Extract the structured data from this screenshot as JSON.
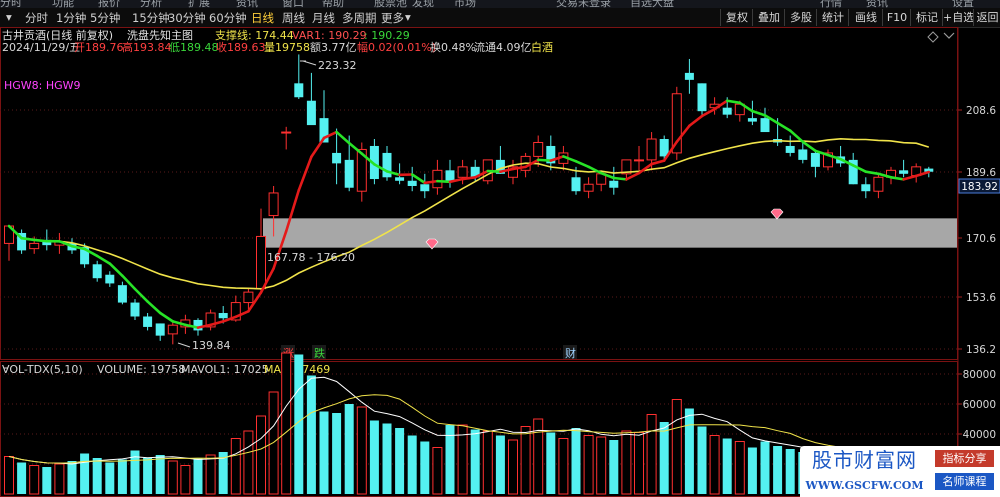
{
  "top_strip": {
    "items": [
      "分时",
      "功能",
      "报价",
      "分析",
      "扩展",
      "资讯",
      "窗口",
      "帮助",
      "股票池",
      "发现",
      "市场",
      "交易未登录",
      "自选大盘",
      "行情",
      "资讯",
      "设置"
    ]
  },
  "period_tabs": [
    {
      "label": "分时",
      "active": false
    },
    {
      "label": "1分钟",
      "active": false
    },
    {
      "label": "5分钟",
      "active": false
    },
    {
      "label": "15分钟",
      "active": false
    },
    {
      "label": "30分钟",
      "active": false
    },
    {
      "label": "60分钟",
      "active": false
    },
    {
      "label": "日线",
      "active": true
    },
    {
      "label": "周线",
      "active": false
    },
    {
      "label": "月线",
      "active": false
    },
    {
      "label": "多周期",
      "active": false
    },
    {
      "label": "更多",
      "active": false
    }
  ],
  "right_buttons": [
    "复权",
    "叠加",
    "多股",
    "统计",
    "画线",
    "F10",
    "标记",
    "+自选",
    "返回"
  ],
  "stock": {
    "title": "古井贡酒(日线 前复权)",
    "indicator_name": "洗盘先知主图",
    "support_label": "支撑线: 174.44",
    "var1": "VAR1: 190.29",
    "var1_2": ": 190.29"
  },
  "quote_line": {
    "date": "2024/11/29/五",
    "open": "开189.76",
    "high": "高193.84",
    "low": "低189.48",
    "close": "收189.63",
    "volume": "量19758",
    "amount": "额3.77亿",
    "change": "幅0.02(0.01%)",
    "turnover": "换0.48%",
    "float": "流通4.09亿",
    "sector": "白酒"
  },
  "hgw_label": "HGW8: HGW9",
  "price_axis": [
    "208.6",
    "189.6",
    "170.6",
    "153.6",
    "136.2"
  ],
  "current_price_tag": "183.92",
  "annotations": {
    "high_label": "223.32",
    "low_label": "139.84",
    "range_label": "167.78 - 176.20",
    "marker_up": "涨",
    "marker_down": "跌",
    "marker_fin": "财"
  },
  "vol_header": {
    "name": "VOL-TDX(5,10)",
    "volume": "VOLUME: 19758",
    "mavol1": "MAVOL1: 17025",
    "ma5": "MA5: 17469"
  },
  "vol_axis": [
    "80000",
    "60000",
    "40000",
    "20000"
  ],
  "watermark": {
    "site_name": "股市财富网",
    "site_url": "WWW.GSCFW.COM",
    "badge1": "指标分享",
    "badge2": "名师课程"
  },
  "colors": {
    "up": "#ff3030",
    "down": "#54f0f0",
    "trend_up": "#e41a1a",
    "trend_down": "#27e327",
    "support": "#f0e34a",
    "band": "#a7a7a7",
    "accent": "#ffcf3a"
  },
  "chart_data": {
    "type": "candlestick",
    "ohlc": [
      [
        169,
        174,
        164,
        174
      ],
      [
        172,
        173,
        166,
        167
      ],
      [
        167.5,
        171,
        166,
        169
      ],
      [
        170,
        173,
        167,
        168.5
      ],
      [
        168.5,
        172,
        166,
        169.5
      ],
      [
        169,
        170.5,
        166,
        167
      ],
      [
        168,
        169,
        162,
        163
      ],
      [
        163,
        164,
        158,
        159
      ],
      [
        160,
        161,
        156.5,
        157.5
      ],
      [
        157,
        158,
        151.5,
        152
      ],
      [
        152,
        153,
        147,
        148
      ],
      [
        148,
        149,
        144,
        145
      ],
      [
        146,
        146,
        141,
        142.5
      ],
      [
        143,
        147,
        140,
        145.5
      ],
      [
        145,
        148.5,
        143,
        147
      ],
      [
        147,
        147.5,
        142.5,
        144
      ],
      [
        145,
        150,
        144,
        149
      ],
      [
        149,
        151,
        146,
        147.5
      ],
      [
        147,
        154,
        146.5,
        152
      ],
      [
        152,
        156,
        150,
        155
      ],
      [
        156,
        179,
        155,
        171
      ],
      [
        177,
        185.5,
        171,
        183.5
      ],
      [
        201,
        202.5,
        196,
        201
      ],
      [
        215,
        223.3,
        210.5,
        211
      ],
      [
        210,
        218,
        205,
        203
      ],
      [
        205,
        213,
        198,
        198
      ],
      [
        195,
        202,
        186,
        192
      ],
      [
        193,
        200,
        184,
        185
      ],
      [
        184,
        198,
        181,
        196
      ],
      [
        197,
        199,
        186,
        187.5
      ],
      [
        195,
        197,
        187,
        188
      ],
      [
        188,
        192,
        186,
        187
      ],
      [
        187,
        191,
        184,
        185.5
      ],
      [
        186,
        189,
        182,
        184
      ],
      [
        185,
        193,
        183,
        190
      ],
      [
        190,
        193,
        185,
        187
      ],
      [
        188,
        193,
        186,
        191
      ],
      [
        191,
        193,
        187,
        188
      ],
      [
        187,
        193,
        186,
        193
      ],
      [
        193,
        197,
        189,
        189
      ],
      [
        188,
        193,
        186,
        191
      ],
      [
        190,
        195,
        188,
        194
      ],
      [
        194,
        200,
        191,
        198
      ],
      [
        197,
        200,
        190,
        192
      ],
      [
        192,
        197,
        190,
        195
      ],
      [
        188,
        191,
        183,
        184
      ],
      [
        184,
        188,
        182,
        186
      ],
      [
        186,
        190,
        184,
        189
      ],
      [
        187,
        191,
        183,
        185
      ],
      [
        189,
        193,
        187,
        193
      ],
      [
        193,
        197,
        190,
        193
      ],
      [
        193,
        201,
        190,
        199
      ],
      [
        199,
        200,
        193,
        194
      ],
      [
        195,
        214,
        193,
        212
      ],
      [
        218,
        222,
        212,
        216
      ],
      [
        215,
        215,
        206,
        207
      ],
      [
        208,
        211,
        206,
        209
      ],
      [
        208,
        211,
        205,
        206
      ],
      [
        206,
        210,
        204,
        209
      ],
      [
        205,
        210,
        203,
        204
      ],
      [
        205,
        208,
        201,
        201
      ],
      [
        199,
        205,
        197,
        198
      ],
      [
        197,
        200,
        194,
        195
      ],
      [
        196,
        198,
        192,
        193
      ],
      [
        195,
        196,
        188,
        191
      ],
      [
        191,
        196,
        190,
        195
      ],
      [
        194,
        197,
        191,
        192
      ],
      [
        193,
        195,
        186,
        186
      ],
      [
        186,
        188,
        182,
        184
      ],
      [
        184,
        189,
        182,
        188
      ],
      [
        188,
        191,
        186,
        190
      ],
      [
        190,
        193,
        188,
        189
      ],
      [
        188.5,
        192,
        186.5,
        191
      ],
      [
        190.5,
        191,
        188,
        189.6
      ]
    ],
    "volume": [
      25000,
      21000,
      19000,
      18000,
      20000,
      22000,
      27000,
      24000,
      21000,
      23000,
      29000,
      24000,
      26000,
      22000,
      19000,
      24000,
      26000,
      28000,
      37000,
      42000,
      52000,
      68000,
      94000,
      93000,
      79000,
      55000,
      54000,
      60000,
      58000,
      49000,
      47000,
      44000,
      39000,
      35000,
      31000,
      46000,
      46000,
      43000,
      42000,
      39000,
      36000,
      45000,
      50000,
      41000,
      37000,
      44000,
      39000,
      38000,
      36000,
      42000,
      41000,
      53000,
      48000,
      63000,
      57000,
      45000,
      39000,
      37000,
      35000,
      31000,
      35000,
      32000,
      30000,
      28000,
      31000,
      27000,
      25000,
      27000,
      24000,
      22000,
      21000,
      20000,
      20000,
      19758
    ]
  }
}
